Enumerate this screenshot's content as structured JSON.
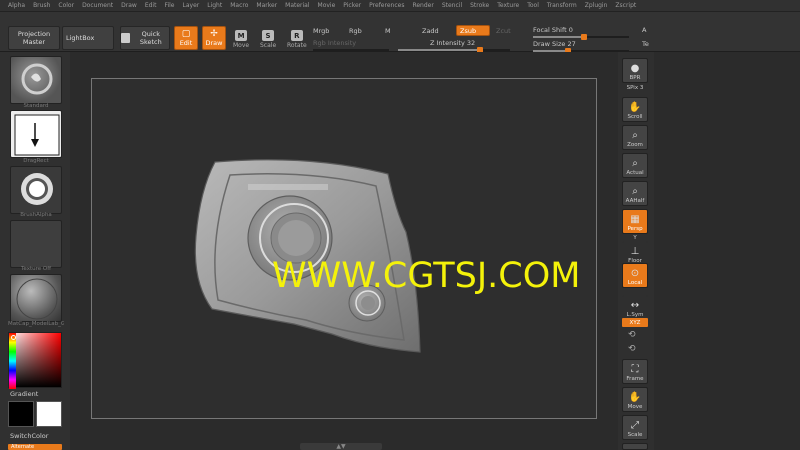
{
  "menu": [
    "Alpha",
    "Brush",
    "Color",
    "Document",
    "Draw",
    "Edit",
    "File",
    "Layer",
    "Light",
    "Macro",
    "Marker",
    "Material",
    "Movie",
    "Picker",
    "Preferences",
    "Render",
    "Stencil",
    "Stroke",
    "Texture",
    "Tool",
    "Transform",
    "Zplugin",
    "Zscript"
  ],
  "toolbar": {
    "projection_master": "Projection Master",
    "lightbox": "LightBox",
    "quick_sketch": "Quick Sketch",
    "edit": "Edit",
    "draw": "Draw",
    "move": "Move",
    "scale": "Scale",
    "rotate": "Rotate",
    "move_key": "M",
    "scale_key": "S",
    "rotate_key": "R",
    "mrgb": "Mrgb",
    "rgb": "Rgb",
    "m": "M",
    "zadd": "Zadd",
    "zsub": "Zsub",
    "zcut": "Zcut",
    "rgb_intensity": "Rgb Intensity",
    "z_intensity_label": "Z Intensity",
    "z_intensity_value": "32",
    "focal_shift_label": "Focal Shift",
    "focal_shift_value": "0",
    "draw_size_label": "Draw Size",
    "draw_size_value": "27",
    "edge_a1": "A",
    "edge_a2": "Te"
  },
  "left": {
    "brush_label": "Standard",
    "stroke_label": "DragRect",
    "alpha_label": "BrushAlpha",
    "texture_label": "Texture Off",
    "material_label": "MatCap_ModelLab_Gr",
    "gradient_label": "Gradient",
    "switch_color_label": "SwitchColor",
    "alternate_label": "Alternate"
  },
  "right": {
    "bpr": "BPR",
    "spix_label": "SPix",
    "spix_value": "3",
    "scroll": "Scroll",
    "zoom": "Zoom",
    "actual": "Actual",
    "aahalf": "AAHalf",
    "persp": "Persp",
    "y_label": "Y",
    "floor": "Floor",
    "local": "Local",
    "lsym": "L.Sym",
    "xyz": "XYZ",
    "frame": "Frame",
    "move": "Move",
    "scale": "Scale"
  },
  "canvas": {
    "watermark": "WWW.CGTSJ.COM"
  },
  "colors": {
    "accent": "#e97a1b",
    "watermark": "#f4f20a",
    "background": "#2b2b2b"
  }
}
